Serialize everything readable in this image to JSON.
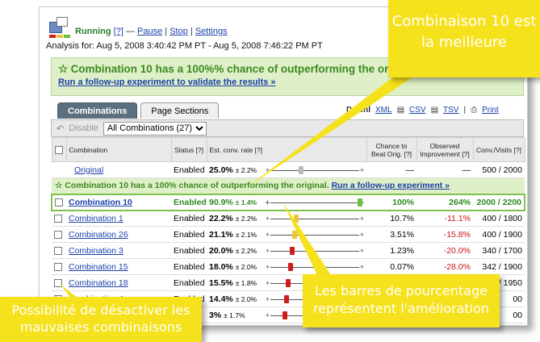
{
  "header": {
    "running": "Running",
    "help": "[?]",
    "dash": "—",
    "pause": "Pause",
    "stop": "Stop",
    "settings": "Settings",
    "sep": "|",
    "analysis": "Analysis for: Aug 5, 2008 3:40:42 PM PT - Aug 5, 2008 7:46:22 PM PT"
  },
  "banner": {
    "title": "Combination 10 has a 100%% chance of outperforming the original",
    "link": "Run a follow-up experiment to validate the results »"
  },
  "tabs": [
    {
      "label": "Combinations"
    },
    {
      "label": "Page Sections"
    }
  ],
  "downloads": {
    "label": "Downl",
    "xml": "XML",
    "csv": "CSV",
    "tsv": "TSV",
    "print": "Print",
    "sep": "|"
  },
  "toolbar": {
    "disable": "Disable",
    "select_value": "All Combinations (27)"
  },
  "columns": {
    "combination": "Combination",
    "status": "Status [?]",
    "rate": "Est. conv. rate [?]",
    "chance": "Chance to Beat Orig. [?]",
    "improvement": "Observed Improvement [?]",
    "visits": "Conv./Visits [?]"
  },
  "rows": {
    "original": {
      "name": "Original",
      "status": "Enabled",
      "rate": "25.0%",
      "err": "± 2.2%",
      "chance": "—",
      "improvement": "—",
      "visits": "500 / 2000",
      "mark": 0.31,
      "color": "#b9b9b9"
    },
    "winner_banner": {
      "text": "Combination 10 has a 100% chance of outperforming the original.",
      "link": "Run a follow-up experiment »"
    },
    "winner": {
      "name": "Combination 10",
      "status": "Enabled",
      "rate": "90.9%",
      "err": "± 1.4%",
      "chance": "100%",
      "improvement": "264%",
      "visits": "2000 / 2200",
      "mark": 0.97,
      "color": "#6cbf3e"
    },
    "others": [
      {
        "name": "Combination 1",
        "status": "Enabled",
        "rate": "22.2%",
        "err": "± 2.2%",
        "chance": "10.7%",
        "improvement": "-11.1%",
        "visits": "400 / 1800",
        "mark": 0.26,
        "color": "#f0c23a"
      },
      {
        "name": "Combination 26",
        "status": "Enabled",
        "rate": "21.1%",
        "err": "± 2.1%",
        "chance": "3.51%",
        "improvement": "-15.8%",
        "visits": "400 / 1900",
        "mark": 0.24,
        "color": "#f0c23a"
      },
      {
        "name": "Combination 3",
        "status": "Enabled",
        "rate": "20.0%",
        "err": "± 2.2%",
        "chance": "1.23%",
        "improvement": "-20.0%",
        "visits": "340 / 1700",
        "mark": 0.22,
        "color": "#d01b1b"
      },
      {
        "name": "Combination 15",
        "status": "Enabled",
        "rate": "18.0%",
        "err": "± 2.0%",
        "chance": "0.07%",
        "improvement": "-28.0%",
        "visits": "342 / 1900",
        "mark": 0.2,
        "color": "#d01b1b"
      },
      {
        "name": "Combination 18",
        "status": "Enabled",
        "rate": "15.5%",
        "err": "± 1.8%",
        "chance": "0.00%",
        "improvement": "-38.1%",
        "visits": "302 / 1950",
        "mark": 0.17,
        "color": "#d01b1b"
      },
      {
        "name": "Combination 4",
        "status": "Enabled",
        "rate": "14.4%",
        "err": "± 2.0%",
        "chance": "",
        "improvement": "",
        "visits": "00",
        "mark": 0.15,
        "color": "#d01b1b"
      },
      {
        "name": "",
        "status": "",
        "rate": "3%",
        "err": "± 1.7%",
        "chance": "",
        "improvement": "",
        "visits": "00",
        "mark": 0.14,
        "color": "#d01b1b"
      }
    ]
  },
  "callouts": {
    "best": "Combinaison 10 est la meilleure",
    "disable": "Possibilité de désactiver les mauvaises combinaisons",
    "bars": "Les barres de pourcentage représentent l'amélioration"
  }
}
